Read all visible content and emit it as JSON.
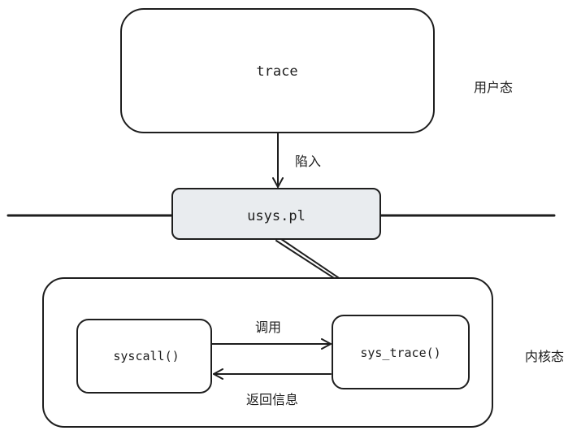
{
  "nodes": {
    "trace": "trace",
    "usys": "usys.pl",
    "syscall": "syscall()",
    "sys_trace": "sys_trace()"
  },
  "zones": {
    "user": "用户态",
    "kernel": "内核态"
  },
  "edges": {
    "trap": "陷入",
    "call": "调用",
    "return": "返回信息"
  }
}
